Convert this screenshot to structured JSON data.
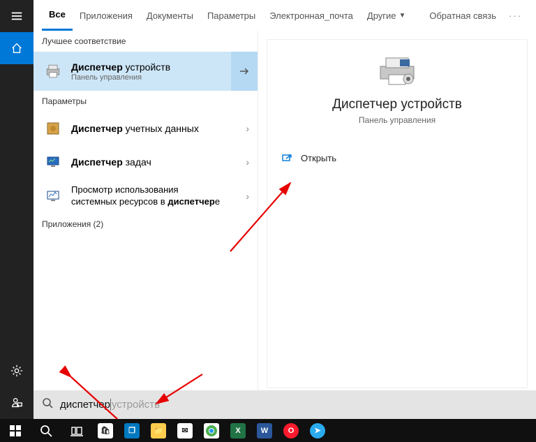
{
  "tabs": {
    "all": "Все",
    "apps": "Приложения",
    "docs": "Документы",
    "settings": "Параметры",
    "email": "Электронная_почта",
    "more": "Другие",
    "feedback": "Обратная связь"
  },
  "sections": {
    "best_match": "Лучшее соответствие",
    "settings": "Параметры",
    "apps": "Приложения (2)"
  },
  "bestMatch": {
    "title_bold": "Диспетчер",
    "title_rest": " устройств",
    "sub": "Панель управления"
  },
  "settingsResults": [
    {
      "title_bold": "Диспетчер",
      "title_rest": " учетных данных"
    },
    {
      "title_bold": "Диспетчер",
      "title_rest": " задач"
    },
    {
      "line1": "Просмотр использования",
      "line2_a": "системных ресурсов в ",
      "line2_b": "диспетчер",
      "line2_c": "е"
    }
  ],
  "preview": {
    "title": "Диспетчер устройств",
    "sub": "Панель управления",
    "open": "Открыть"
  },
  "search": {
    "typed": "диспетчер",
    "hint": " устройств"
  }
}
